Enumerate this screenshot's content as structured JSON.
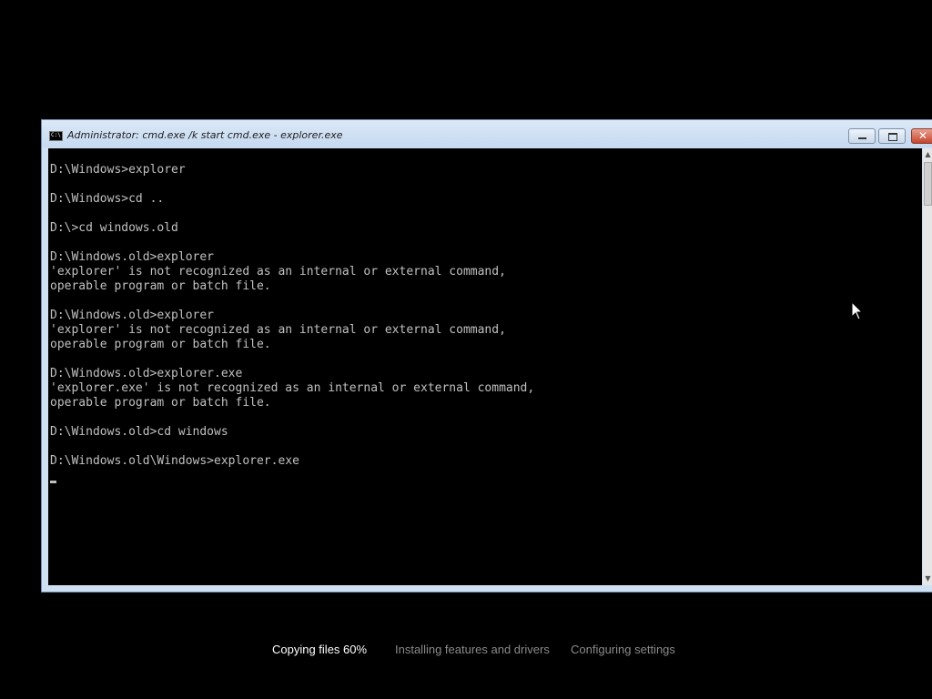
{
  "window": {
    "title": "Administrator: cmd.exe /k start cmd.exe - explorer.exe",
    "icon": "cmd-icon",
    "controls": [
      "minimize",
      "maximize",
      "close"
    ]
  },
  "console": {
    "text": "D:\\Windows>explorer\n\nD:\\Windows>cd ..\n\nD:\\>cd windows.old\n\nD:\\Windows.old>explorer\n'explorer' is not recognized as an internal or external command,\noperable program or batch file.\n\nD:\\Windows.old>explorer\n'explorer' is not recognized as an internal or external command,\noperable program or batch file.\n\nD:\\Windows.old>explorer.exe\n'explorer.exe' is not recognized as an internal or external command,\noperable program or batch file.\n\nD:\\Windows.old>cd windows\n\nD:\\Windows.old\\Windows>explorer.exe",
    "text_color": "#c0c0c0",
    "background": "#000000"
  },
  "setup_progress": {
    "steps": [
      {
        "label": "Copying files 60%",
        "active": true
      },
      {
        "label": "Installing features and drivers",
        "active": false
      },
      {
        "label": "Configuring settings",
        "active": false
      }
    ]
  }
}
